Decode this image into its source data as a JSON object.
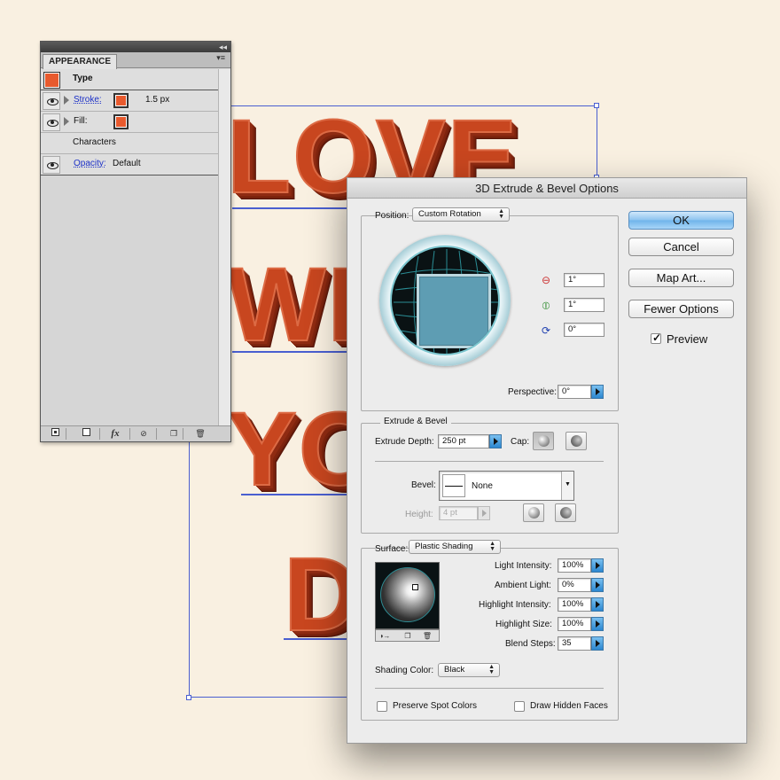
{
  "artboard": {
    "words": [
      "LOVE",
      "WI",
      "YO",
      "D"
    ]
  },
  "appearance_panel": {
    "tab": "APPEARANCE",
    "type_label": "Type",
    "stroke_label": "Stroke:",
    "stroke_value": "1.5 px",
    "fill_label": "Fill:",
    "characters_label": "Characters",
    "opacity_label": "Opacity:",
    "opacity_value": "Default",
    "swatch_color": "#e85a2e",
    "footer_icons": [
      "new-art-basic-appearance-icon",
      "clear-appearance-icon",
      "fx-icon",
      "no-effect-icon",
      "duplicate-item-icon",
      "delete-item-icon"
    ],
    "fx_glyph": "fx"
  },
  "dialog": {
    "title": "3D Extrude & Bevel Options",
    "position_label": "Position:",
    "position_value": "Custom Rotation",
    "rot_x": "1°",
    "rot_y": "1°",
    "rot_z": "0°",
    "perspective_label": "Perspective:",
    "perspective_value": "0°",
    "extrude_group_label": "Extrude & Bevel",
    "extrude_depth_label": "Extrude Depth:",
    "extrude_depth_value": "250 pt",
    "cap_label": "Cap:",
    "bevel_label": "Bevel:",
    "bevel_value": "None",
    "height_label": "Height:",
    "height_value": "4 pt",
    "surface_label": "Surface:",
    "surface_value": "Plastic Shading",
    "light_intensity_label": "Light Intensity:",
    "light_intensity_value": "100%",
    "ambient_light_label": "Ambient Light:",
    "ambient_light_value": "0%",
    "highlight_intensity_label": "Highlight Intensity:",
    "highlight_intensity_value": "100%",
    "highlight_size_label": "Highlight Size:",
    "highlight_size_value": "100%",
    "blend_steps_label": "Blend Steps:",
    "blend_steps_value": "35",
    "shading_color_label": "Shading Color:",
    "shading_color_value": "Black",
    "preserve_spot_label": "Preserve Spot Colors",
    "preserve_spot_checked": false,
    "draw_hidden_label": "Draw Hidden Faces",
    "draw_hidden_checked": false,
    "ok_label": "OK",
    "cancel_label": "Cancel",
    "map_art_label": "Map Art...",
    "fewer_options_label": "Fewer Options",
    "preview_label": "Preview",
    "preview_checked": true
  }
}
